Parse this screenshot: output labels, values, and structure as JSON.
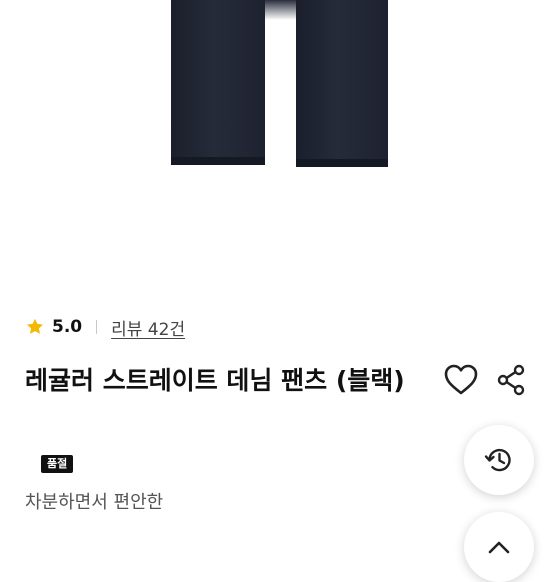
{
  "product": {
    "rating": "5.0",
    "review_link": "리뷰 42건",
    "title": "레귤러 스트레이트 데님 팬츠 (블랙)",
    "badge": "품절",
    "subtitle": "차분하면서 편안한"
  },
  "icons": {
    "rating": "star-icon",
    "wishlist": "heart-icon",
    "share": "share-icon",
    "history": "history-icon",
    "scroll_top": "chevron-up-icon"
  },
  "colors": {
    "star": "#F5B800",
    "text": "#111111",
    "muted": "#555555",
    "badge_bg": "#111111"
  }
}
